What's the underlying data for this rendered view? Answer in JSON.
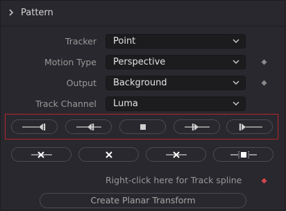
{
  "section": {
    "title": "Pattern",
    "expand_icon": "chevron-right-icon"
  },
  "fields": {
    "tracker": {
      "label": "Tracker",
      "value": "Point"
    },
    "motion_type": {
      "label": "Motion Type",
      "value": "Perspective"
    },
    "output": {
      "label": "Output",
      "value": "Background"
    },
    "track_channel": {
      "label": "Track Channel",
      "value": "Luma"
    }
  },
  "track_buttons": [
    "track-reverse-icon",
    "step-reverse-icon",
    "stop-icon",
    "step-forward-icon",
    "track-forward-icon"
  ],
  "clear_buttons": [
    "clear-before-icon",
    "clear-all-icon",
    "clear-after-icon",
    "set-range-icon"
  ],
  "track_spline": {
    "hint": "Right-click here for Track spline"
  },
  "create_planar_transform": {
    "label": "Create Planar Transform"
  },
  "colors": {
    "highlight_border": "#b8262a",
    "keyframe_active": "#d2464b",
    "keyframe_inactive": "#8a8a8a"
  }
}
